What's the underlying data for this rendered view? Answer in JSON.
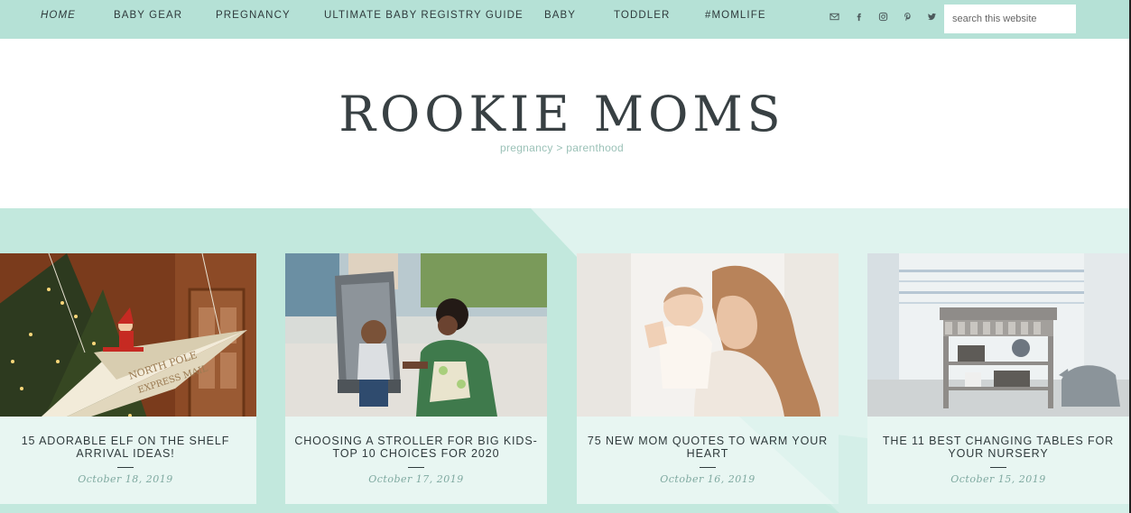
{
  "nav": {
    "items": [
      "HOME",
      "BABY GEAR",
      "PREGNANCY",
      "ULTIMATE BABY REGISTRY GUIDE",
      "BABY",
      "TODDLER",
      "#MOMLIFE"
    ],
    "social": [
      "envelope-icon",
      "facebook-icon",
      "instagram-icon",
      "pinterest-icon",
      "twitter-icon"
    ],
    "search_placeholder": "search this website"
  },
  "header": {
    "title": "ROOKIE MOMS",
    "tagline": "pregnancy > parenthood"
  },
  "colors": {
    "nav_bg": "#b5e1d6",
    "band_bg": "#c2e8dd",
    "band_light": "#dff3ee",
    "card_body": "#e8f6f2",
    "title_text": "#384043",
    "date_text": "#7fa9a0"
  },
  "posts": [
    {
      "title": "15 ADORABLE ELF ON THE SHELF ARRIVAL IDEAS!",
      "date": "October 18, 2019",
      "image": "elf-paper-airplane-christmas-tree"
    },
    {
      "title": "CHOOSING A STROLLER FOR BIG KIDS- TOP 10 CHOICES FOR 2020",
      "date": "October 17, 2019",
      "image": "child-in-stroller-with-mother"
    },
    {
      "title": "75 NEW MOM QUOTES TO WARM YOUR HEART",
      "date": "October 16, 2019",
      "image": "mother-holding-baby"
    },
    {
      "title": "THE 11 BEST CHANGING TABLES FOR YOUR NURSERY",
      "date": "October 15, 2019",
      "image": "gray-changing-table-nursery"
    }
  ]
}
